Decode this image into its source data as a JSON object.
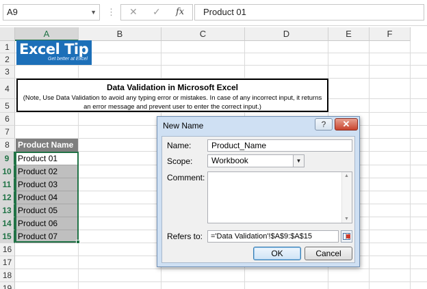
{
  "formula_bar": {
    "name_box": "A9",
    "separator": "⋮",
    "cancel_glyph": "✕",
    "enter_glyph": "✓",
    "function_glyph": "fx",
    "formula": "Product 01"
  },
  "columns": [
    "A",
    "B",
    "C",
    "D",
    "E",
    "F"
  ],
  "rows": [
    "1",
    "2",
    "3",
    "4",
    "5",
    "6",
    "7",
    "8",
    "9",
    "10",
    "11",
    "12",
    "13",
    "14",
    "15",
    "16",
    "17",
    "18",
    "19"
  ],
  "logo": {
    "word": "Excel",
    "tip": "Tip",
    "tagline": "Get better at Excel"
  },
  "title_box": {
    "title": "Data Validation in Microsoft Excel",
    "note": "(Note, Use Data Validation to avoid any typing error or mistakes. In case of any incorrect input, it returns an error message and prevent user to enter the correct input.)"
  },
  "products": {
    "header": "Product Name",
    "items": [
      "Product 01",
      "Product 02",
      "Product 03",
      "Product 04",
      "Product 05",
      "Product 06",
      "Product 07"
    ]
  },
  "dialog": {
    "title": "New Name",
    "help": "?",
    "close": "✕",
    "name_label": "Name:",
    "name_value": "Product_Name",
    "scope_label": "Scope:",
    "scope_value": "Workbook",
    "comment_label": "Comment:",
    "refers_label": "Refers to:",
    "refers_value": "='Data Validation'!$A$9:$A$15",
    "ok": "OK",
    "cancel": "Cancel"
  },
  "colors": {
    "excel_green": "#217346",
    "logo_blue": "#1c6fb8",
    "header_gray": "#7f7f7f",
    "cell_gray": "#bfbfbf"
  }
}
